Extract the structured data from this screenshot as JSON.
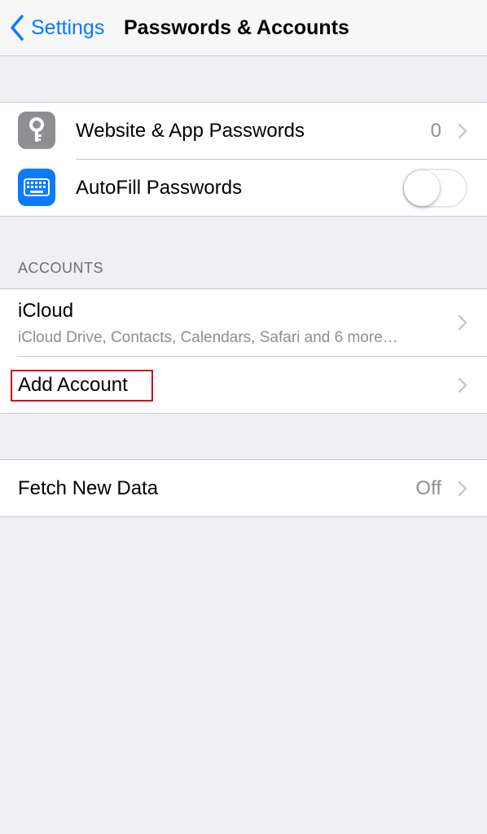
{
  "navbar": {
    "back_label": "Settings",
    "title": "Passwords & Accounts"
  },
  "passwords_group": {
    "website_passwords": {
      "label": "Website & App Passwords",
      "count": "0",
      "icon": "key-icon",
      "icon_color": "#8e8e93"
    },
    "autofill": {
      "label": "AutoFill Passwords",
      "icon": "keyboard-icon",
      "icon_color": "#0a7aff",
      "enabled": false
    }
  },
  "accounts": {
    "header": "ACCOUNTS",
    "items": [
      {
        "label": "iCloud",
        "detail": "iCloud Drive, Contacts, Calendars, Safari and 6 more…"
      },
      {
        "label": "Add Account"
      }
    ]
  },
  "fetch": {
    "label": "Fetch New Data",
    "value": "Off"
  },
  "colors": {
    "accent": "#007aff",
    "background": "#efeff4",
    "secondary_text": "#8e8e93",
    "highlight": "#d0021b"
  }
}
